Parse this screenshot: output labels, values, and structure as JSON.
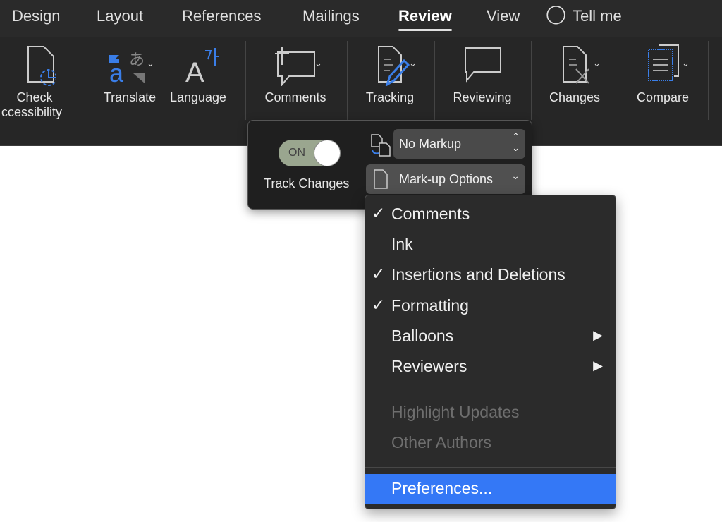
{
  "tabs": [
    {
      "label": "Design"
    },
    {
      "label": "Layout"
    },
    {
      "label": "References"
    },
    {
      "label": "Mailings"
    },
    {
      "label": "Review"
    },
    {
      "label": "View"
    },
    {
      "label": "Tell me"
    }
  ],
  "active_tab": "Review",
  "ribbon": {
    "check_accessibility": [
      "Check",
      "ccessibility"
    ],
    "translate": "Translate",
    "language": "Language",
    "comments": "Comments",
    "tracking": "Tracking",
    "reviewing": "Reviewing",
    "changes": "Changes",
    "compare": "Compare"
  },
  "tracking_popover": {
    "toggle_state": "ON",
    "track_changes_label": "Track Changes",
    "display_select": "No Markup",
    "markup_options": "Mark-up Options"
  },
  "markup_menu": {
    "items": [
      {
        "label": "Comments",
        "checked": true
      },
      {
        "label": "Ink",
        "checked": false
      },
      {
        "label": "Insertions and Deletions",
        "checked": true
      },
      {
        "label": "Formatting",
        "checked": true
      },
      {
        "label": "Balloons",
        "submenu": true
      },
      {
        "label": "Reviewers",
        "submenu": true
      },
      {
        "label": "Highlight Updates",
        "disabled": true
      },
      {
        "label": "Other Authors",
        "disabled": true
      },
      {
        "label": "Preferences...",
        "highlighted": true
      }
    ]
  },
  "colors": {
    "accent": "#3478f6",
    "icon_blue": "#3a7ee8",
    "toggle": "#9aa68f"
  }
}
